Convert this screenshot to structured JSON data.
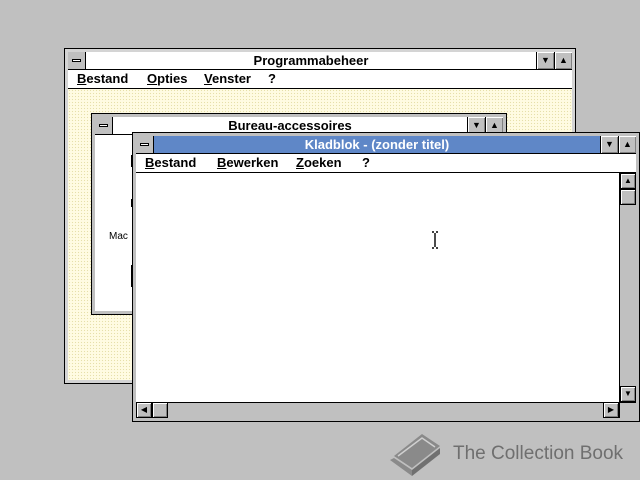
{
  "program_manager": {
    "title": "Programmabeheer",
    "menu": [
      "Bestand",
      "Opties",
      "Venster",
      "?"
    ]
  },
  "accessories": {
    "title": "Bureau-accessoires",
    "partial_label": "Mac"
  },
  "notepad": {
    "title": "Kladblok - (zonder titel)",
    "menu": [
      "Bestand",
      "Bewerken",
      "Zoeken",
      "?"
    ]
  },
  "watermark": {
    "text": "The Collection Book"
  },
  "icons": {
    "system_menu": "system-menu-icon",
    "minimize": "minimize-arrow-icon",
    "maximize": "maximize-arrow-icon",
    "text_cursor": "i-beam-cursor-icon",
    "book": "book-icon"
  },
  "colors": {
    "desktop": "#c0c0c0",
    "active_title": "#5f87c7",
    "workspace": "#fffbe2"
  }
}
